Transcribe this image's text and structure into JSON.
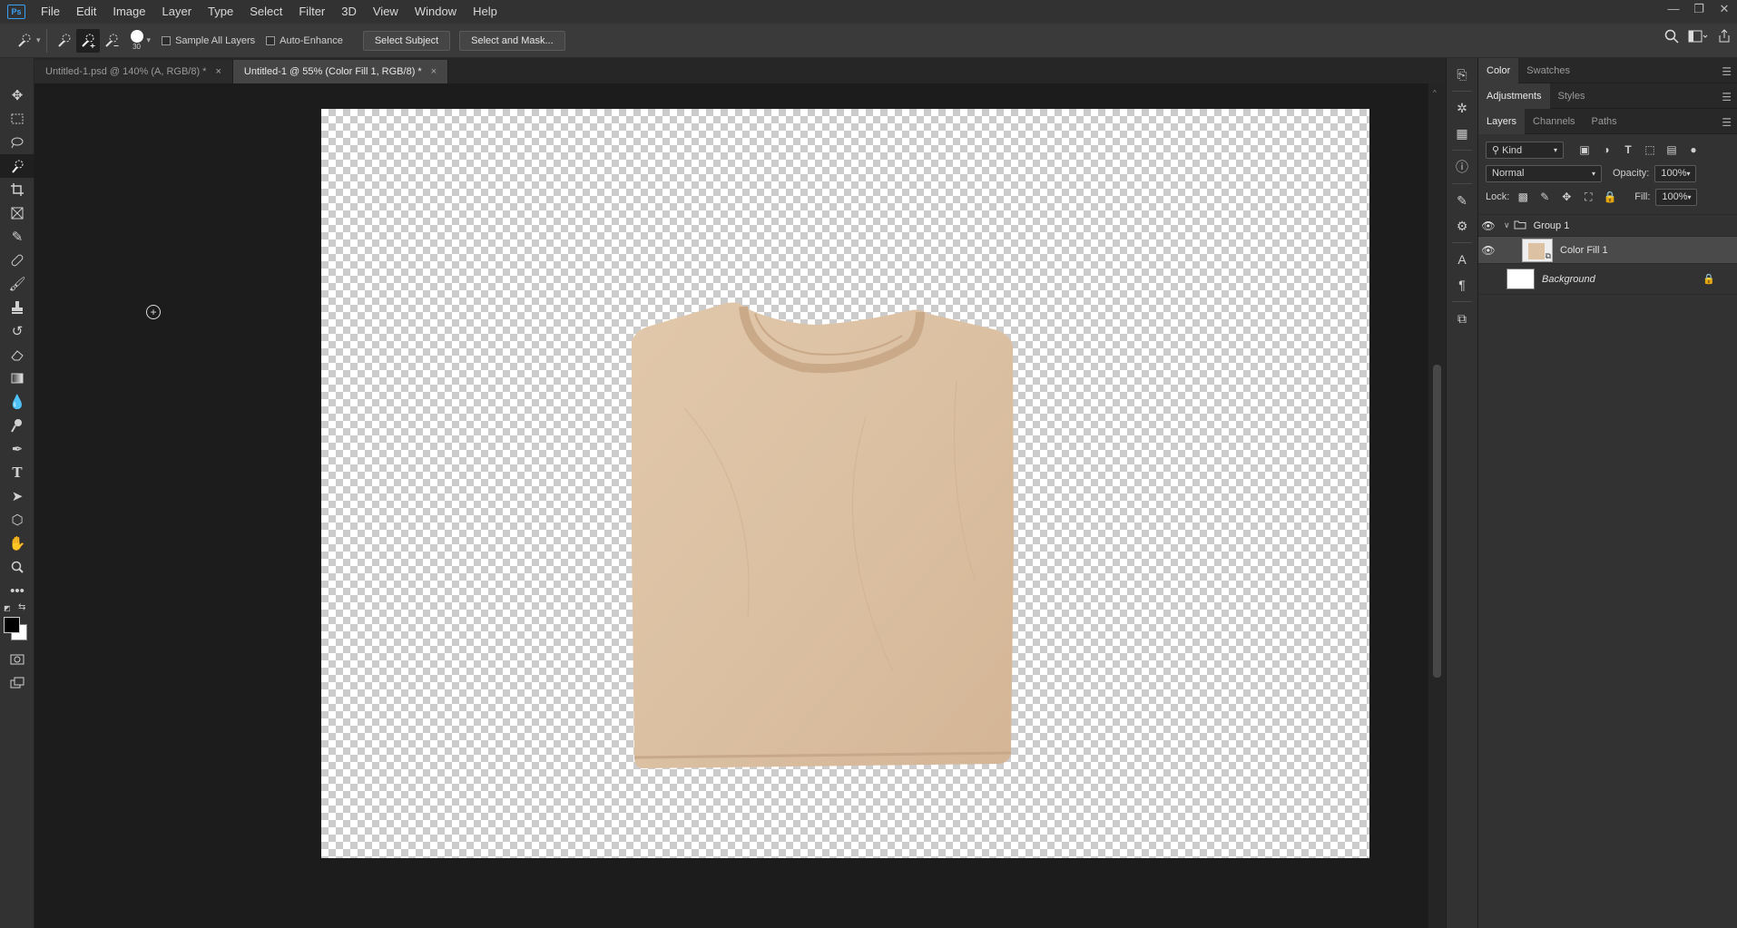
{
  "app": {
    "logo": "Ps"
  },
  "menu": [
    "File",
    "Edit",
    "Image",
    "Layer",
    "Type",
    "Select",
    "Filter",
    "3D",
    "View",
    "Window",
    "Help"
  ],
  "window_controls": [
    "—",
    "❐",
    "✕"
  ],
  "options": {
    "brush_size": "30",
    "sample_all_layers": "Sample All Layers",
    "auto_enhance": "Auto-Enhance",
    "select_subject": "Select Subject",
    "select_and_mask": "Select and Mask..."
  },
  "tabs": [
    {
      "label": "Untitled-1.psd @ 140% (A, RGB/8) *",
      "close": "×"
    },
    {
      "label": "Untitled-1 @ 55% (Color Fill 1, RGB/8) *",
      "close": "×"
    }
  ],
  "panels": {
    "color_tabs": [
      "Color",
      "Swatches"
    ],
    "adjust_tabs": [
      "Adjustments",
      "Styles"
    ],
    "layer_tabs": [
      "Layers",
      "Channels",
      "Paths"
    ],
    "filter_kind": "Kind",
    "blend_mode": "Normal",
    "opacity_label": "Opacity:",
    "opacity_value": "100%",
    "lock_label": "Lock:",
    "fill_label": "Fill:",
    "fill_value": "100%",
    "layers": [
      {
        "name": "Group 1"
      },
      {
        "name": "Color Fill 1"
      },
      {
        "name": "Background"
      }
    ]
  },
  "colors": {
    "shirt": "#dcc1a3",
    "accent": "#3aa0f3"
  }
}
